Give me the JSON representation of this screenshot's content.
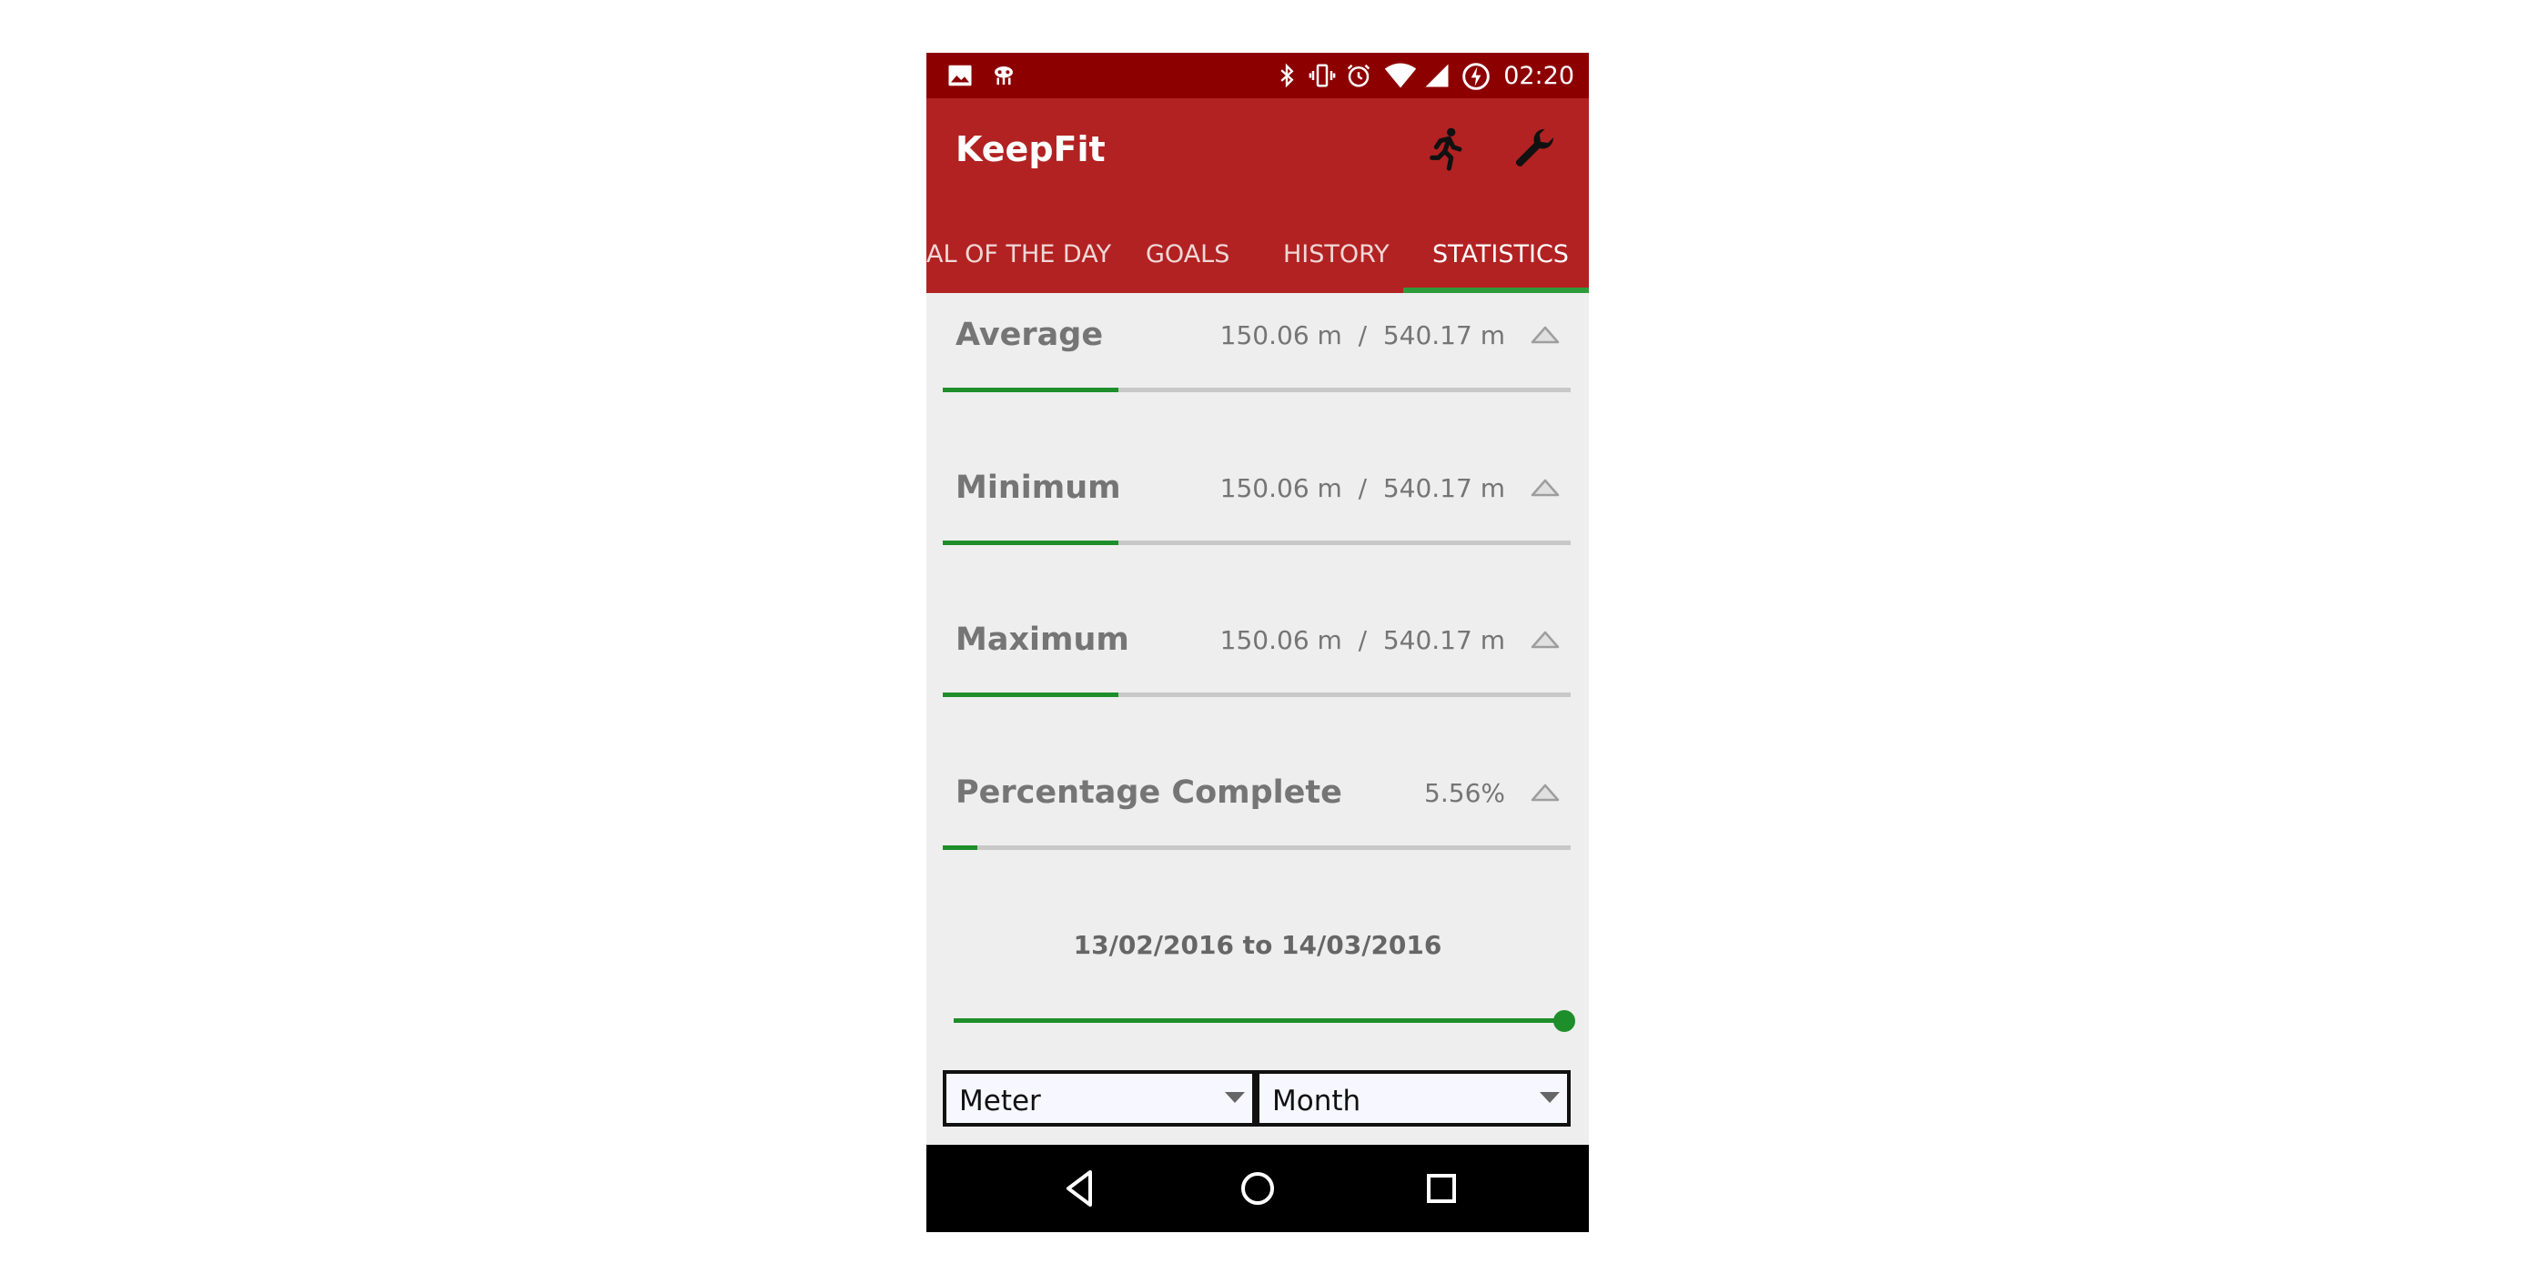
{
  "status_bar": {
    "time": "02:20",
    "left_icons": [
      "image-notification-icon",
      "android-debug-icon"
    ],
    "right_icons": [
      "bluetooth-icon",
      "vibrate-icon",
      "alarm-icon",
      "wifi-icon",
      "cell-signal-icon",
      "battery-charging-icon"
    ]
  },
  "app_bar": {
    "title": "KeepFit",
    "actions": [
      "running-man-icon",
      "wrench-icon"
    ]
  },
  "tabs": [
    {
      "label": "AL OF THE DAY",
      "active": false
    },
    {
      "label": "GOALS",
      "active": false
    },
    {
      "label": "HISTORY",
      "active": false
    },
    {
      "label": "STATISTICS",
      "active": true
    }
  ],
  "stats": [
    {
      "label": "Average",
      "value": "150.06 m  /  540.17 m",
      "progress": 0.28
    },
    {
      "label": "Minimum",
      "value": "150.06 m  /  540.17 m",
      "progress": 0.28
    },
    {
      "label": "Maximum",
      "value": "150.06 m  /  540.17 m",
      "progress": 0.28
    },
    {
      "label": "Percentage Complete",
      "value": "5.56%",
      "progress": 0.0556
    }
  ],
  "date_range": {
    "text": "13/02/2016 to 14/03/2016",
    "slider_value": 1.0
  },
  "dropdowns": {
    "unit": {
      "value": "Meter"
    },
    "period": {
      "value": "Month"
    }
  },
  "colors": {
    "status_bar": "#8c0000",
    "app_bar": "#b22222",
    "accent": "#1e8e2a",
    "background": "#eeeeee"
  }
}
